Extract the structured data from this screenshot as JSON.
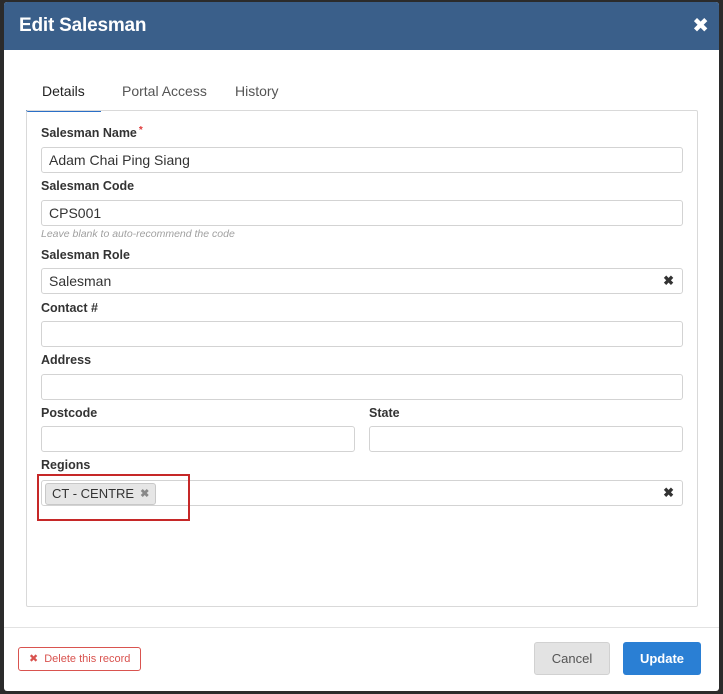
{
  "modal": {
    "title": "Edit Salesman",
    "close_icon": "close-icon"
  },
  "tabs": [
    {
      "label": "Details",
      "active": true
    },
    {
      "label": "Portal Access",
      "active": false
    },
    {
      "label": "History",
      "active": false
    }
  ],
  "form": {
    "salesman_name": {
      "label": "Salesman Name",
      "required_marker": "*",
      "value": "Adam Chai Ping Siang"
    },
    "salesman_code": {
      "label": "Salesman Code",
      "value": "CPS001",
      "hint": "Leave blank to auto-recommend the code"
    },
    "salesman_role": {
      "label": "Salesman Role",
      "value": "Salesman",
      "clear_glyph": "✖"
    },
    "contact": {
      "label": "Contact #",
      "value": ""
    },
    "address": {
      "label": "Address",
      "value": ""
    },
    "postcode": {
      "label": "Postcode",
      "value": ""
    },
    "state": {
      "label": "State",
      "value": ""
    },
    "regions": {
      "label": "Regions",
      "tags": [
        "CT - CENTRE"
      ],
      "tag_remove_glyph": "✖",
      "clear_glyph": "✖"
    }
  },
  "footer": {
    "delete_label": "Delete this record",
    "delete_glyph": "✖",
    "cancel_label": "Cancel",
    "update_label": "Update"
  },
  "colors": {
    "header": "#3a5f8a",
    "primary": "#2a7fd4",
    "danger": "#d9534f",
    "highlight": "#c62828"
  }
}
